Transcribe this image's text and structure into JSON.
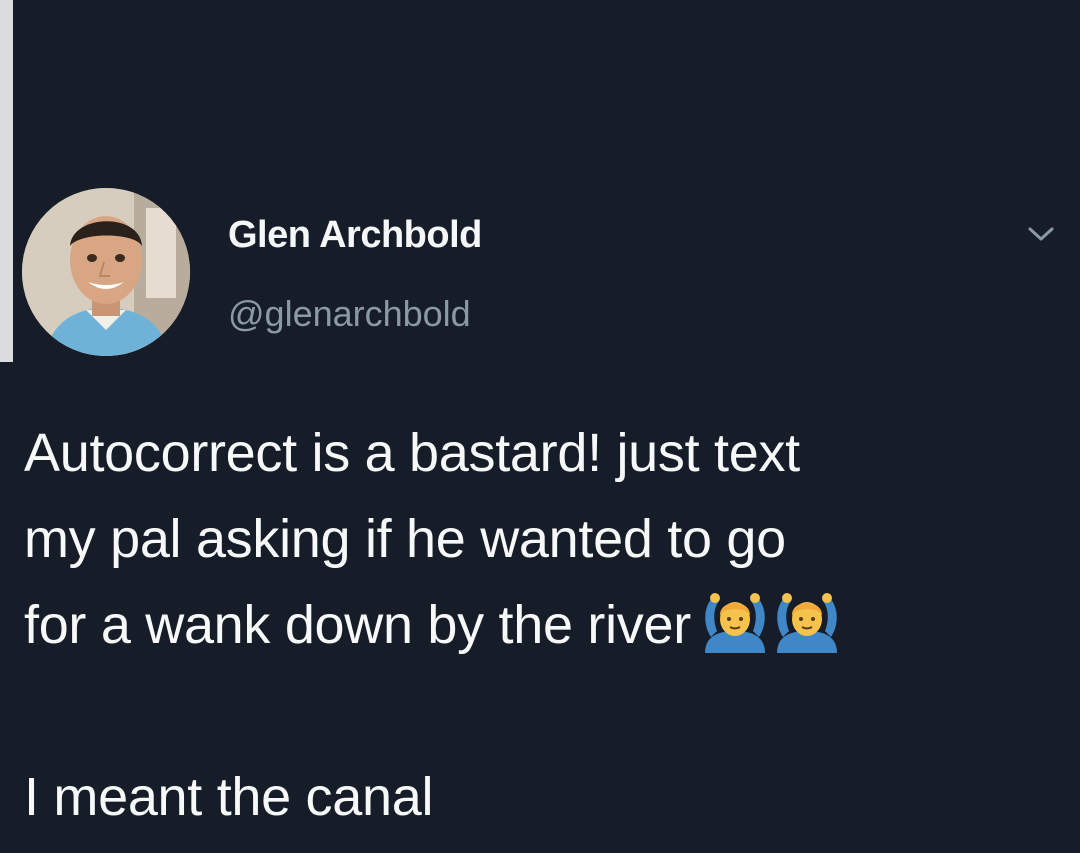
{
  "tweet": {
    "author": {
      "display_name": "Glen Archbold",
      "handle": "@glenarchbold",
      "avatar_icon": "profile-photo"
    },
    "menu_icon": "chevron-down-icon",
    "text_lines": [
      "Autocorrect is a bastard! just text",
      "my pal asking if he wanted to go",
      "for a wank down by the river"
    ],
    "emoji": [
      "man-gesturing-ok",
      "man-gesturing-ok"
    ],
    "last_line": "I meant the canal"
  },
  "colors": {
    "background": "#161d28",
    "text": "#f7f9f9",
    "secondary_text": "#8b98a5"
  }
}
